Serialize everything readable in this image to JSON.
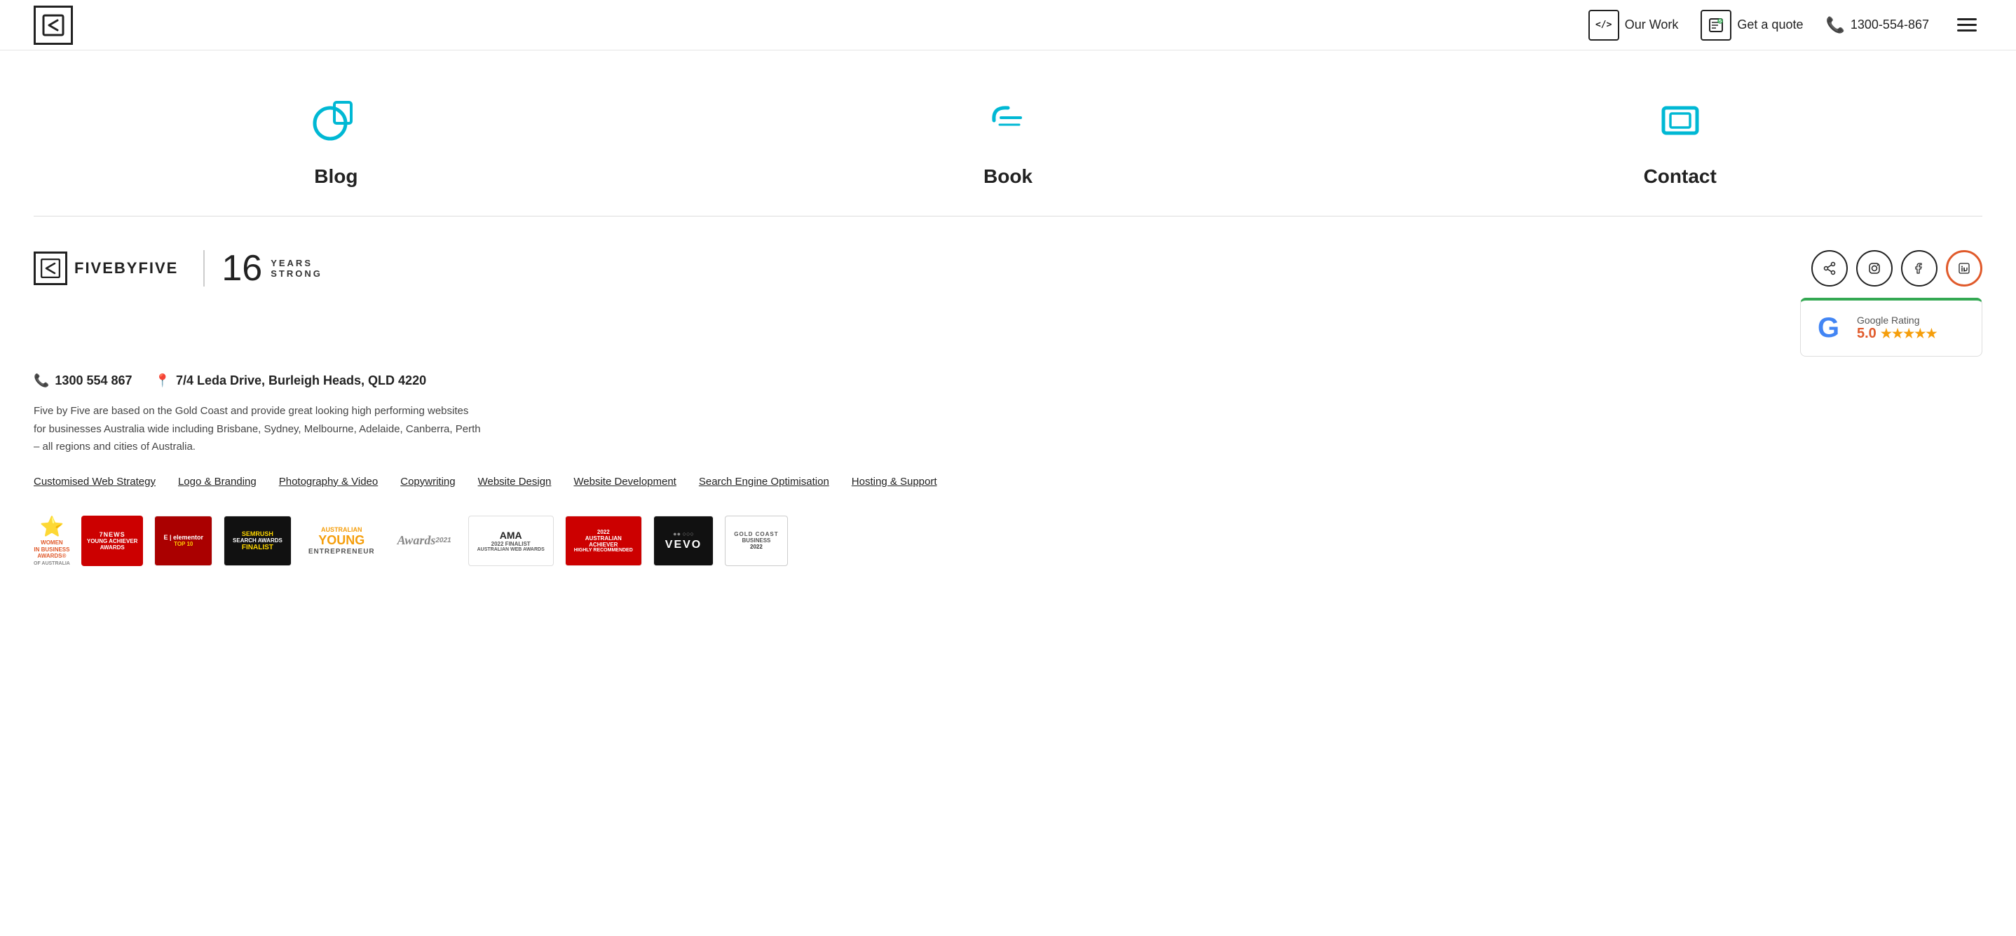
{
  "header": {
    "logo_symbol": "◀",
    "nav": {
      "our_work_label": "Our Work",
      "get_quote_label": "Get a quote",
      "phone": "1300-554-867"
    }
  },
  "main_sections": {
    "blog": {
      "label": "Blog"
    },
    "book": {
      "label": "Book"
    },
    "contact": {
      "label": "Contact"
    }
  },
  "footer": {
    "brand_name": "FIVEBYFIVE",
    "brand_tagline": "16 YEARS STRONG",
    "years_big": "16",
    "years_text1": "YEARS",
    "years_text2": "STRONG",
    "phone": "1300 554 867",
    "address": "7/4 Leda Drive, Burleigh Heads, QLD 4220",
    "description": "Five by Five are based on the Gold Coast and provide great looking high performing websites for businesses Australia wide including Brisbane, Sydney, Melbourne, Adelaide, Canberra, Perth – all regions and cities of Australia.",
    "links": [
      "Customised Web Strategy",
      "Logo & Branding",
      "Photography & Video",
      "Copywriting",
      "Website Design",
      "Website Development",
      "Search Engine Optimisation",
      "Hosting & Support"
    ],
    "google_rating": {
      "label": "Google Rating",
      "score": "5.0",
      "stars": "★★★★★"
    },
    "social": {
      "share": "⤢",
      "instagram": "◯",
      "facebook": "f",
      "linkedin": "in"
    },
    "badges": [
      {
        "label": "WOMEN IN BUSINESS AWARDS® OF AUSTRALIA",
        "type": "women"
      },
      {
        "label": "7 NEWS YOUNG ACHIEVER AWARDS",
        "type": "young-achiever"
      },
      {
        "label": "TOP 10 ELEMENTOR",
        "type": "elementor"
      },
      {
        "label": "SEMRUSH SEARCH AWARDS FINALIST",
        "type": "semrush"
      },
      {
        "label": "AUSTRALIAN YOUNG ENTREPRENEUR",
        "type": "au-young"
      },
      {
        "label": "Awards 2021",
        "type": "awards"
      },
      {
        "label": "AMA 2022 FINALIST AUSTRALIAN WEB AWARDS",
        "type": "ama"
      },
      {
        "label": "2022 AUSTRALIAN ACHIEVER HIGHLY RECOMMENDED",
        "type": "achiever"
      },
      {
        "label": "VEVO",
        "type": "vevo"
      },
      {
        "label": "GOLD COAST BUSINESS 2022",
        "type": "gold-coast"
      }
    ]
  }
}
